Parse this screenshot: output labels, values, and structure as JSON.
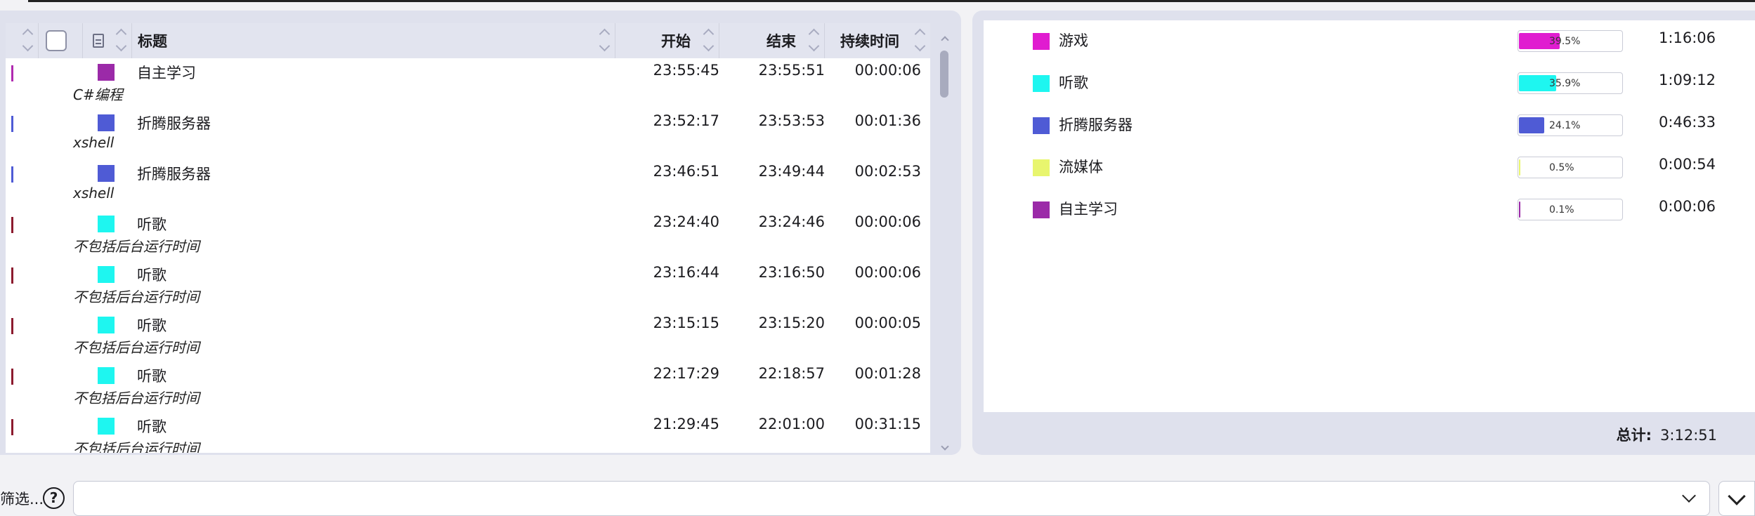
{
  "list": {
    "headers": {
      "title": "标题",
      "start": "开始",
      "end": "结束",
      "duration": "持续时间"
    },
    "rows": [
      {
        "title": "自主学习",
        "subtitle": "C#编程",
        "start": "23:55:45",
        "end": "23:55:51",
        "duration": "00:00:06",
        "color": "#9b2aa8",
        "bar_color": "#b02ab0"
      },
      {
        "title": "折腾服务器",
        "subtitle": "xshell",
        "start": "23:52:17",
        "end": "23:53:53",
        "duration": "00:01:36",
        "color": "#4f5bd5",
        "bar_color": "#4f5bd5"
      },
      {
        "title": "折腾服务器",
        "subtitle": "xshell",
        "start": "23:46:51",
        "end": "23:49:44",
        "duration": "00:02:53",
        "color": "#4f5bd5",
        "bar_color": "#4f5bd5"
      },
      {
        "title": "听歌",
        "subtitle": "不包括后台运行时间",
        "start": "23:24:40",
        "end": "23:24:46",
        "duration": "00:00:06",
        "color": "#1ef6f0",
        "bar_color": "#8c1a2e"
      },
      {
        "title": "听歌",
        "subtitle": "不包括后台运行时间",
        "start": "23:16:44",
        "end": "23:16:50",
        "duration": "00:00:06",
        "color": "#1ef6f0",
        "bar_color": "#8c1a2e"
      },
      {
        "title": "听歌",
        "subtitle": "不包括后台运行时间",
        "start": "23:15:15",
        "end": "23:15:20",
        "duration": "00:00:05",
        "color": "#1ef6f0",
        "bar_color": "#8c1a2e"
      },
      {
        "title": "听歌",
        "subtitle": "不包括后台运行时间",
        "start": "22:17:29",
        "end": "22:18:57",
        "duration": "00:01:28",
        "color": "#1ef6f0",
        "bar_color": "#8c1a2e"
      },
      {
        "title": "听歌",
        "subtitle": "不包括后台运行时间",
        "start": "21:29:45",
        "end": "22:01:00",
        "duration": "00:31:15",
        "color": "#1ef6f0",
        "bar_color": "#8c1a2e"
      }
    ]
  },
  "stats": {
    "items": [
      {
        "name": "游戏",
        "percent": "39.5%",
        "fraction": 0.395,
        "duration": "1:16:06",
        "color": "#e01cd0"
      },
      {
        "name": "听歌",
        "percent": "35.9%",
        "fraction": 0.359,
        "duration": "1:09:12",
        "color": "#1ef6f0"
      },
      {
        "name": "折腾服务器",
        "percent": "24.1%",
        "fraction": 0.241,
        "duration": "0:46:33",
        "color": "#4f5bd5"
      },
      {
        "name": "流媒体",
        "percent": "0.5%",
        "fraction": 0.005,
        "duration": "0:00:54",
        "color": "#e8f56e"
      },
      {
        "name": "自主学习",
        "percent": "0.1%",
        "fraction": 0.001,
        "duration": "0:00:06",
        "color": "#9b2aa8"
      }
    ],
    "total_label": "总计:",
    "total_value": "3:12:51"
  },
  "filter": {
    "label": "筛选...",
    "help_symbol": "?",
    "value": ""
  }
}
